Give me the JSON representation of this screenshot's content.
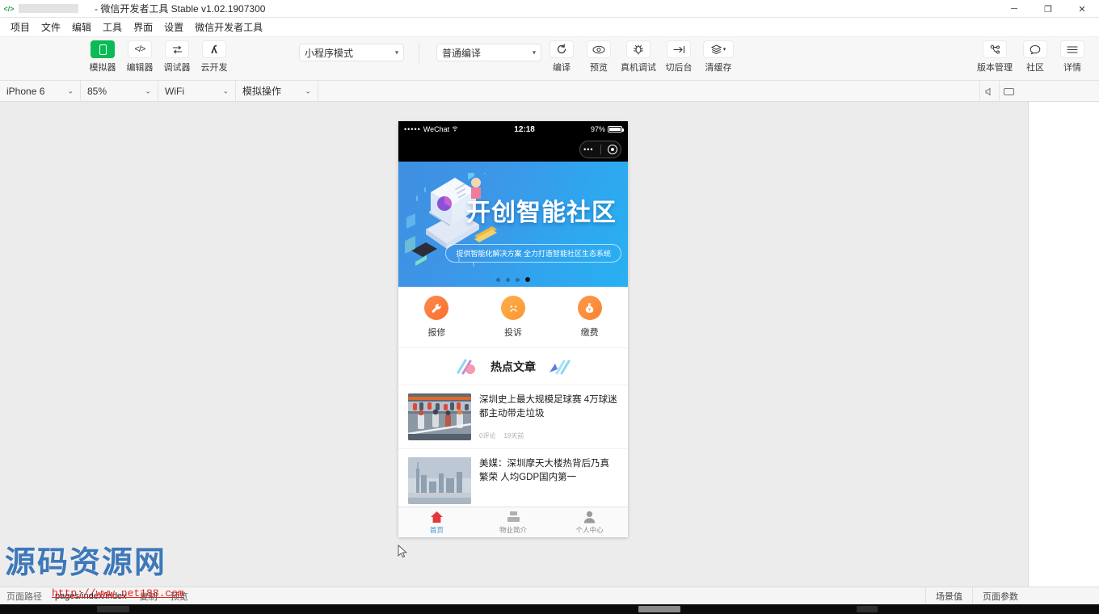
{
  "window": {
    "title": "- 微信开发者工具 Stable v1.02.1907300",
    "logo_icon": "code-brackets-icon",
    "controls": [
      {
        "name": "minimize",
        "glyph": "─"
      },
      {
        "name": "restore",
        "glyph": "❐"
      },
      {
        "name": "close",
        "glyph": "✕"
      }
    ]
  },
  "menubar": {
    "items": [
      "项目",
      "文件",
      "编辑",
      "工具",
      "界面",
      "设置",
      "微信开发者工具"
    ]
  },
  "toolbar": {
    "left_buttons": [
      {
        "label": "模拟器",
        "icon": "phone-icon",
        "glyph": "▯",
        "accent": true
      },
      {
        "label": "编辑器",
        "icon": "code-icon",
        "glyph": "‹›",
        "accent": false
      },
      {
        "label": "调试器",
        "icon": "debug-arrows-icon",
        "glyph": "⇄",
        "accent": false
      },
      {
        "label": "云开发",
        "icon": "cloud-dev-icon",
        "glyph": "ᛞ",
        "accent": false
      }
    ],
    "mode_select": {
      "value": "小程序模式",
      "caret": "▾"
    },
    "compile_select": {
      "value": "普通编译",
      "caret": "▾"
    },
    "action_buttons": [
      {
        "label": "编译",
        "icon": "refresh-icon",
        "glyph": "⟳"
      },
      {
        "label": "预览",
        "icon": "eye-icon",
        "glyph": "◎"
      },
      {
        "label": "真机调试",
        "icon": "bug-icon",
        "glyph": "☣"
      },
      {
        "label": "切后台",
        "icon": "switch-background-icon",
        "glyph": "↦"
      },
      {
        "label": "清缓存",
        "icon": "layers-icon",
        "glyph": "≡",
        "caret": "▾"
      }
    ],
    "right_buttons": [
      {
        "label": "版本管理",
        "icon": "branch-icon",
        "glyph": "⚭"
      },
      {
        "label": "社区",
        "icon": "chat-bubble-icon",
        "glyph": "○"
      },
      {
        "label": "详情",
        "icon": "hamburger-icon",
        "glyph": "☰"
      }
    ]
  },
  "devicebar": {
    "device": {
      "value": "iPhone 6",
      "caret": "⌄"
    },
    "zoom": {
      "value": "85%",
      "caret": "⌄"
    },
    "network": {
      "value": "WiFi",
      "caret": "⌄"
    },
    "simulate": {
      "value": "模拟操作",
      "caret": "⌄"
    },
    "icons": [
      {
        "name": "volume-icon",
        "glyph": "ὐA"
      },
      {
        "name": "screen-icon",
        "glyph": "▭"
      }
    ]
  },
  "phone": {
    "statusbar": {
      "carrier": "WeChat",
      "signal_dots": "•••••",
      "wifi_glyph": "ᵠ",
      "time": "12:18",
      "battery_percent": "97%"
    },
    "capsule": {
      "more_icon": "more-dots-icon",
      "more_glyph": "•••",
      "close_icon": "target-circle-icon"
    },
    "banner": {
      "title": "开创智能社区",
      "subtitle": "提供智能化解决方案  全力打造智能社区生态系统",
      "dots_count": 4,
      "active_dot": 3,
      "gradient_from": "#3f8fe0",
      "gradient_to": "#29b0f2"
    },
    "quick_actions": [
      {
        "label": "报修",
        "icon": "wrench-icon",
        "glyph": "ὒ7",
        "color": "#fb7a3c"
      },
      {
        "label": "投诉",
        "icon": "sad-face-icon",
        "glyph": "☹",
        "color": "#fba23c"
      },
      {
        "label": "缴费",
        "icon": "money-bag-icon",
        "glyph": "¥",
        "color": "#fb913c"
      }
    ],
    "hot_section": {
      "title": "热点文章",
      "left_icon": "ribbon-deco-icon",
      "right_icon": "pen-deco-icon"
    },
    "articles": [
      {
        "title": "深圳史上最大规模足球赛 4万球迷都主动带走垃圾",
        "comments": "0评论",
        "time": "19天前",
        "thumb": "stadium-crowd-photo"
      },
      {
        "title": "美媒：深圳摩天大楼热背后乃真繁荣 人均GDP国内第一",
        "comments": "",
        "time": "",
        "thumb": "city-skyline-photo"
      }
    ],
    "tabbar": [
      {
        "label": "首页",
        "icon": "home-icon",
        "active": true
      },
      {
        "label": "物业简介",
        "icon": "building-icon",
        "active": false
      },
      {
        "label": "个人中心",
        "icon": "person-icon",
        "active": false
      }
    ]
  },
  "statusbar": {
    "path_label": "页面路径",
    "path_value": "pages/index/index",
    "copy_label": "复制",
    "preview_label": "预览",
    "scene_label": "场景值",
    "params_label": "页面参数"
  },
  "watermark": {
    "text": "源码资源网",
    "url": "http://www.net188.com",
    "color": "#2f6fb5",
    "url_color": "#e02020"
  }
}
